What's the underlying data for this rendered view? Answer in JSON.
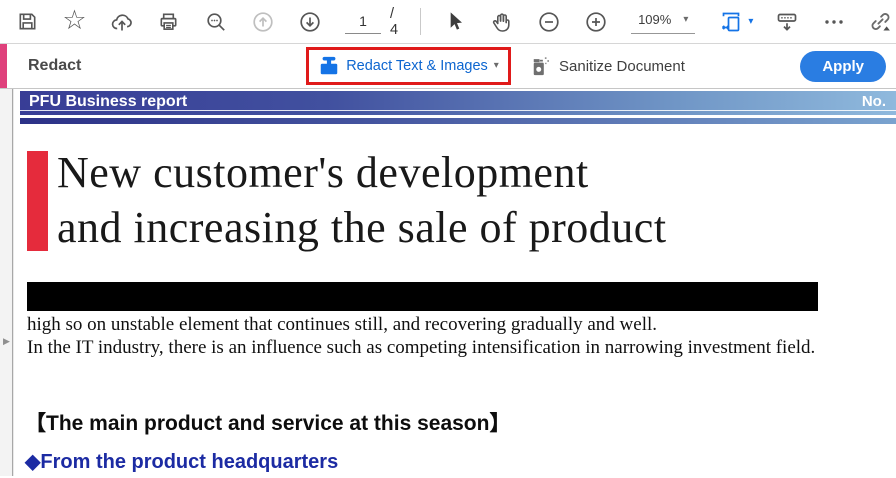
{
  "toolbar_top": {
    "page_number": "1",
    "page_total": "/ 4",
    "zoom_level": "109%",
    "icon_names": [
      "save",
      "star",
      "share-file",
      "print",
      "find",
      "previous-page-disabled",
      "next-page",
      "select-tool",
      "hand-tool",
      "zoom-out",
      "zoom-in",
      "fit-width",
      "hide-toolbar",
      "more-tools",
      "share-link"
    ]
  },
  "icons": {
    "star_glyph": "☆",
    "caret_down": "▾",
    "nav_expand": "▶"
  },
  "toolbar_redact": {
    "title": "Redact",
    "redact_button": "Redact Text & Images",
    "sanitize_button": "Sanitize Document",
    "apply_button": "Apply"
  },
  "document": {
    "header_title": "PFU Business report",
    "header_number": "No.",
    "headline_line1": "New customer's development",
    "headline_line2": "and increasing the sale of product",
    "body_line1": "high so on unstable element that continues still, and recovering gradually and well.",
    "body_line2": "In the IT industry, there is an influence such as competing intensification in narrowing investment field.",
    "section_heading": "【The main product and service at this season】",
    "bullet_item": "◆From the product headquarters"
  },
  "colors": {
    "accent_pink": "#df417c",
    "acrobat_blue": "#1473e6",
    "link_blue": "#0d66d0",
    "apply_blue": "#2a7de2",
    "highlight_red": "#e01a1a",
    "doc_red_block": "#e52b3c",
    "bullet_blue": "#1c2ba3",
    "header_gradient_start": "#383d96",
    "header_gradient_end": "#8fb9dd"
  }
}
